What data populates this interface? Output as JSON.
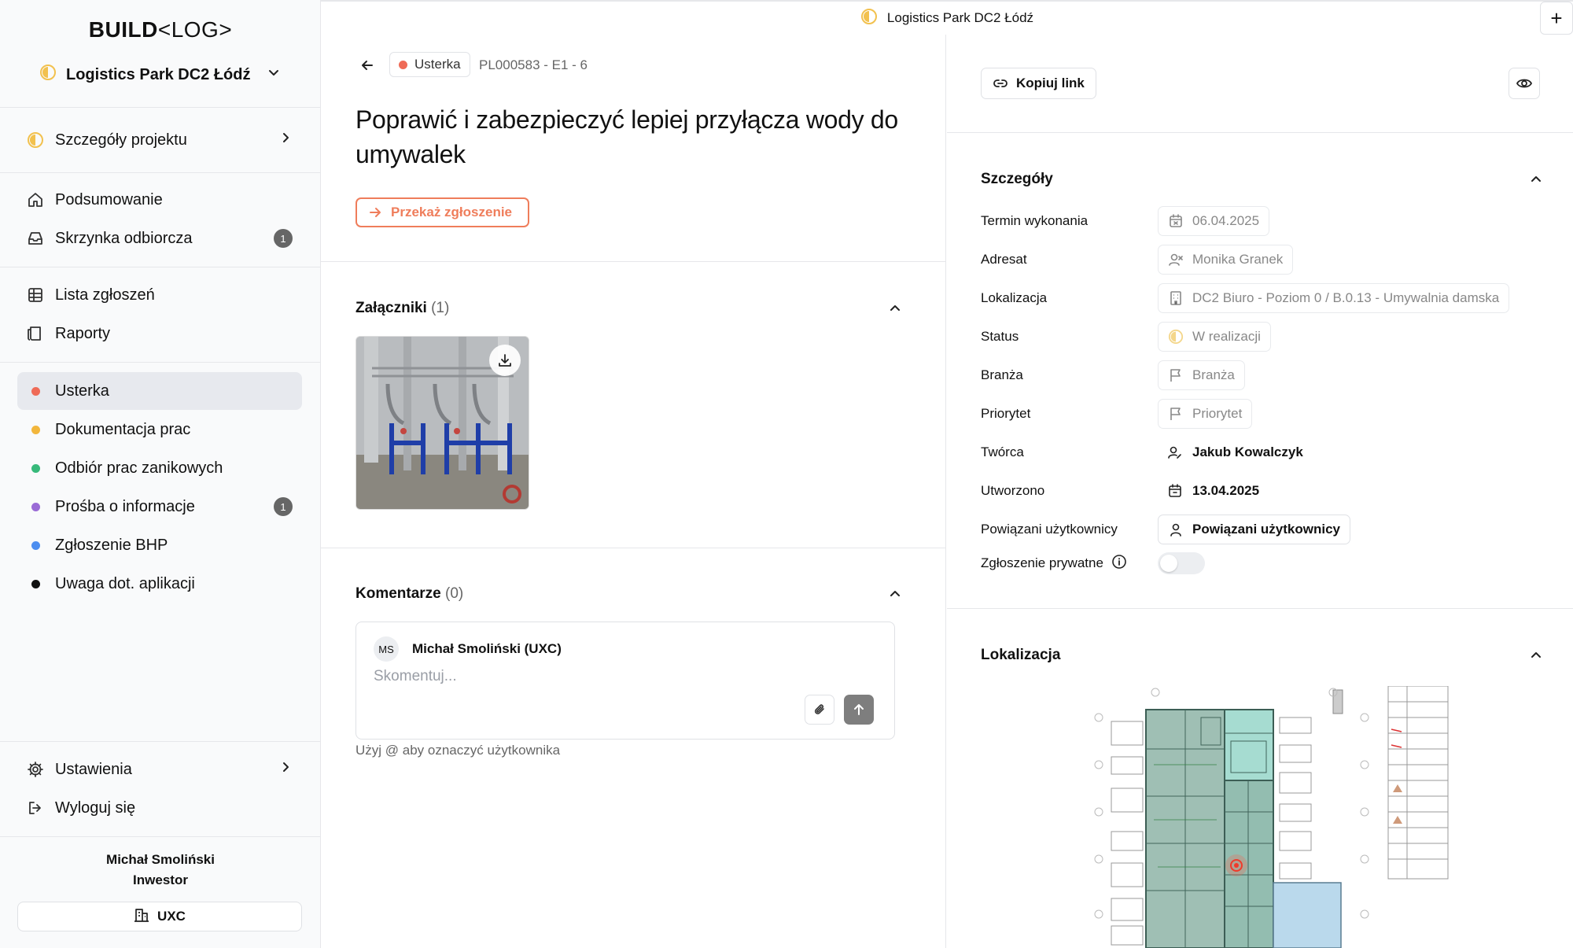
{
  "app": {
    "logo_bold": "BUILD",
    "logo_rest": "<LOG>",
    "project_name": "Logistics Park DC2 Łódź"
  },
  "sidebar": {
    "project_details": "Szczegóły projektu",
    "nav": [
      {
        "label": "Podsumowanie",
        "icon": "home-icon"
      },
      {
        "label": "Skrzynka odbiorcza",
        "icon": "inbox-icon",
        "badge": "1"
      },
      {
        "label": "Lista zgłoszeń",
        "icon": "table-icon"
      },
      {
        "label": "Raporty",
        "icon": "report-icon"
      }
    ],
    "categories": [
      {
        "label": "Usterka",
        "color": "#ef6b57",
        "active": true
      },
      {
        "label": "Dokumentacja prac",
        "color": "#f2b63c"
      },
      {
        "label": "Odbiór prac zanikowych",
        "color": "#37b97a"
      },
      {
        "label": "Prośba o informacje",
        "color": "#9a6bd6",
        "badge": "1"
      },
      {
        "label": "Zgłoszenie BHP",
        "color": "#4d8ef0"
      },
      {
        "label": "Uwaga dot. aplikacji",
        "color": "#111111"
      }
    ],
    "settings": "Ustawienia",
    "logout": "Wyloguj się",
    "user_name": "Michał Smoliński",
    "user_role": "Inwestor",
    "company_button": "UXC"
  },
  "topbar": {
    "project_name": "Logistics Park DC2 Łódź",
    "add_label": "+"
  },
  "ticket": {
    "type_label": "Usterka",
    "type_color": "#ef6b57",
    "id": "PL000583 - E1 - 6",
    "title": "Poprawić i zabezpieczyć lepiej przyłącza wody do umywalek",
    "forward_button": "Przekaż zgłoszenie",
    "attachments_title": "Załączniki",
    "attachments_count": "(1)",
    "comments_title": "Komentarze",
    "comments_count": "(0)",
    "comment_author_initials": "MS",
    "comment_author": "Michał Smoliński (UXC)",
    "comment_placeholder": "Skomentuj...",
    "mention_hint": "Użyj @ aby oznaczyć użytkownika"
  },
  "details": {
    "copy_link": "Kopiuj link",
    "section_title": "Szczegóły",
    "rows": {
      "due_date": {
        "label": "Termin wykonania",
        "value": "06.04.2025"
      },
      "assignee": {
        "label": "Adresat",
        "value": "Monika Granek"
      },
      "location": {
        "label": "Lokalizacja",
        "value": "DC2 Biuro - Poziom 0 / B.0.13 - Umywalnia damska"
      },
      "status": {
        "label": "Status",
        "value": "W realizacji"
      },
      "trade": {
        "label": "Branża",
        "value": "Branża"
      },
      "priority": {
        "label": "Priorytet",
        "value": "Priorytet"
      },
      "creator": {
        "label": "Twórca",
        "value": "Jakub Kowalczyk"
      },
      "created": {
        "label": "Utworzono",
        "value": "13.04.2025"
      },
      "related_users": {
        "label": "Powiązani użytkownicy",
        "value": "Powiązani użytkownicy"
      },
      "private": {
        "label": "Zgłoszenie prywatne",
        "value": false
      }
    },
    "location_section_title": "Lokalizacja"
  },
  "colors": {
    "accent": "#ef7d5b",
    "status_inprogress": "#f2c14e",
    "border": "#e6e7ea",
    "sidebar_bg": "#f9fafb"
  }
}
